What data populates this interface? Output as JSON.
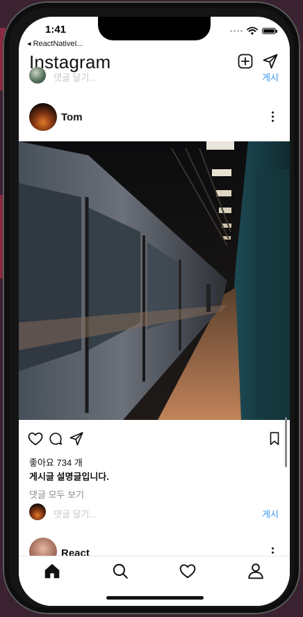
{
  "status_bar": {
    "time": "1:41",
    "back_app": "◂ ReactNativeI..."
  },
  "header": {
    "title": "Instagram",
    "icons": [
      "plus-square-icon",
      "send-icon"
    ]
  },
  "top_comment": {
    "placeholder": "댓글 달기...",
    "post_label": "게시"
  },
  "post": {
    "author": "Tom",
    "likes": "좋아요 734 개",
    "caption": "게시글 설명글입니다.",
    "view_all_comments": "댓글 모두 보기",
    "comment_placeholder": "댓글 달기...",
    "post_label": "게시",
    "action_icons": [
      "heart-icon",
      "comment-icon",
      "share-icon",
      "bookmark-icon"
    ]
  },
  "next_post": {
    "author": "React"
  },
  "tab_bar": {
    "tabs": [
      "home-icon",
      "search-icon",
      "heart-icon",
      "profile-icon"
    ],
    "active": "home-icon"
  }
}
